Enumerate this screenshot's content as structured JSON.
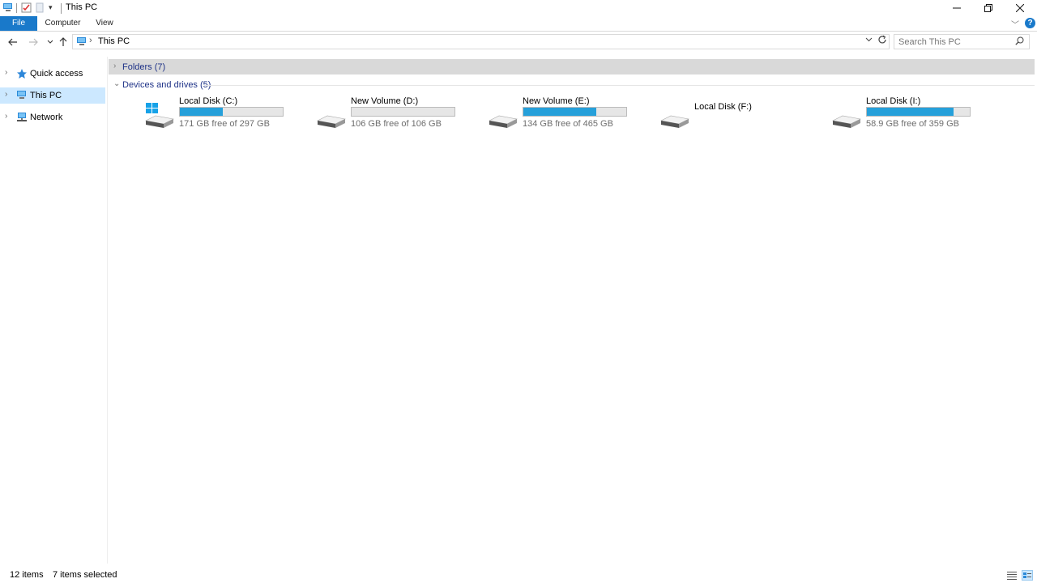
{
  "window": {
    "title": "This PC"
  },
  "ribbon": {
    "tabs": [
      {
        "label": "File"
      },
      {
        "label": "Computer"
      },
      {
        "label": "View"
      }
    ]
  },
  "address": {
    "crumb": "This PC"
  },
  "search": {
    "placeholder": "Search This PC"
  },
  "navpane": {
    "items": [
      {
        "label": "Quick access",
        "icon": "star-icon"
      },
      {
        "label": "This PC",
        "icon": "computer-icon",
        "selected": true
      },
      {
        "label": "Network",
        "icon": "network-icon"
      }
    ]
  },
  "groups": {
    "folders": {
      "title": "Folders (7)",
      "expanded": false
    },
    "devices": {
      "title": "Devices and drives (5)",
      "expanded": true
    }
  },
  "drives": [
    {
      "name": "Local Disk (C:)",
      "free_text": "171 GB free of 297 GB",
      "used_fraction": 0.42,
      "icon": "windows-drive-icon"
    },
    {
      "name": "New Volume (D:)",
      "free_text": "106 GB free of 106 GB",
      "used_fraction": 0.0,
      "icon": "drive-icon"
    },
    {
      "name": "New Volume (E:)",
      "free_text": "134 GB free of 465 GB",
      "used_fraction": 0.71,
      "icon": "drive-icon"
    },
    {
      "name": "Local Disk (F:)",
      "free_text": "",
      "used_fraction": null,
      "icon": "drive-icon"
    },
    {
      "name": "Local Disk (I:)",
      "free_text": "58.9 GB free of 359 GB",
      "used_fraction": 0.84,
      "icon": "drive-icon"
    }
  ],
  "status": {
    "item_count": "12 items",
    "selection": "7 items selected"
  },
  "colors": {
    "accent": "#1979ca",
    "bar_fill": "#26a0da",
    "selection": "#cce8ff",
    "group_title": "#1e3287"
  }
}
